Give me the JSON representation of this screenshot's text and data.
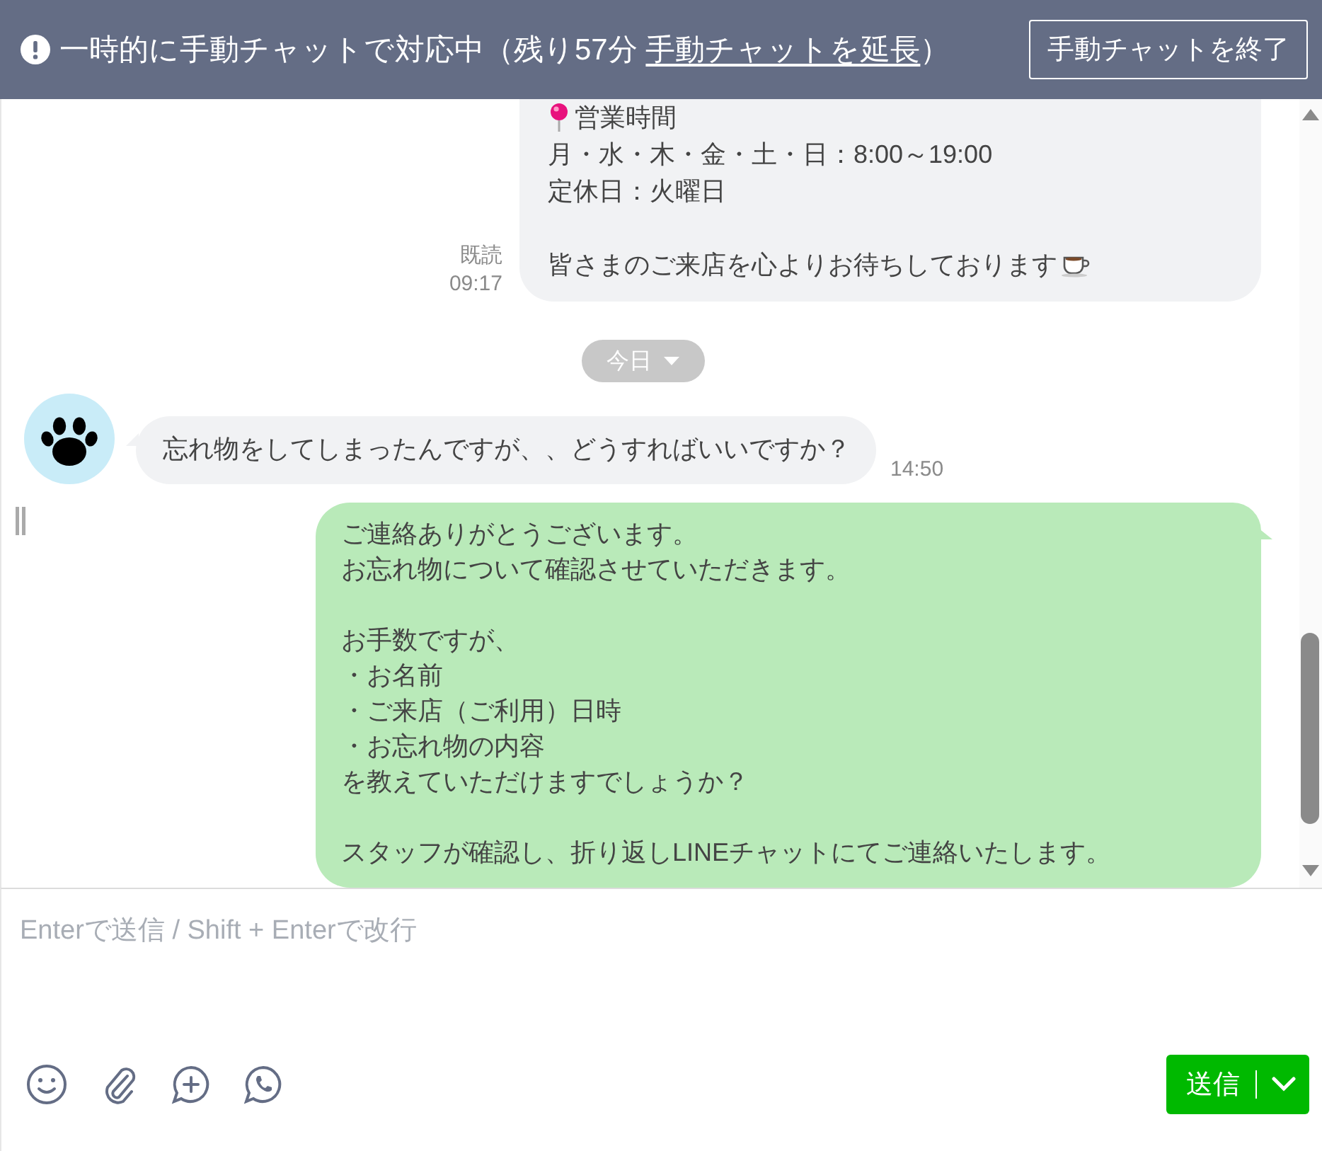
{
  "header": {
    "status": "一時的に手動チャットで対応中（残り57分 ",
    "extend_link": "手動チャットを延長",
    "status_end": "）",
    "end_button": "手動チャットを終了"
  },
  "messages": [
    {
      "kind": "info",
      "outgoing": true,
      "color": "#f1f2f4",
      "paragraphs": [
        [
          "営業時間",
          "月・水・木・金・土・日：8:00～19:00",
          "定休日：火曜日"
        ],
        [
          "皆さまのご来店を心よりお待ちしております"
        ]
      ],
      "read": "既読",
      "time": "09:17"
    },
    {
      "kind": "date",
      "label": "今日"
    },
    {
      "kind": "text",
      "outgoing": false,
      "color": "#f1f2f4",
      "paragraphs": [
        [
          "忘れ物をしてしまったんですが、、どうすればいいですか？"
        ]
      ],
      "time": "14:50"
    },
    {
      "kind": "text",
      "outgoing": true,
      "color": "#b9eab9",
      "paragraphs": [
        [
          "ご連絡ありがとうございます。",
          "お忘れ物について確認させていただきます。"
        ],
        [
          "お手数ですが、",
          "・お名前",
          "・ご来店（ご利用）日時",
          "・お忘れ物の内容",
          "を教えていただけますでしょうか？"
        ],
        [
          "スタッフが確認し、折り返しLINEチャットにてご連絡いたします。"
        ]
      ]
    }
  ],
  "composer": {
    "placeholder": "Enterで送信 / Shift + Enterで改行",
    "send_button": "送信"
  }
}
